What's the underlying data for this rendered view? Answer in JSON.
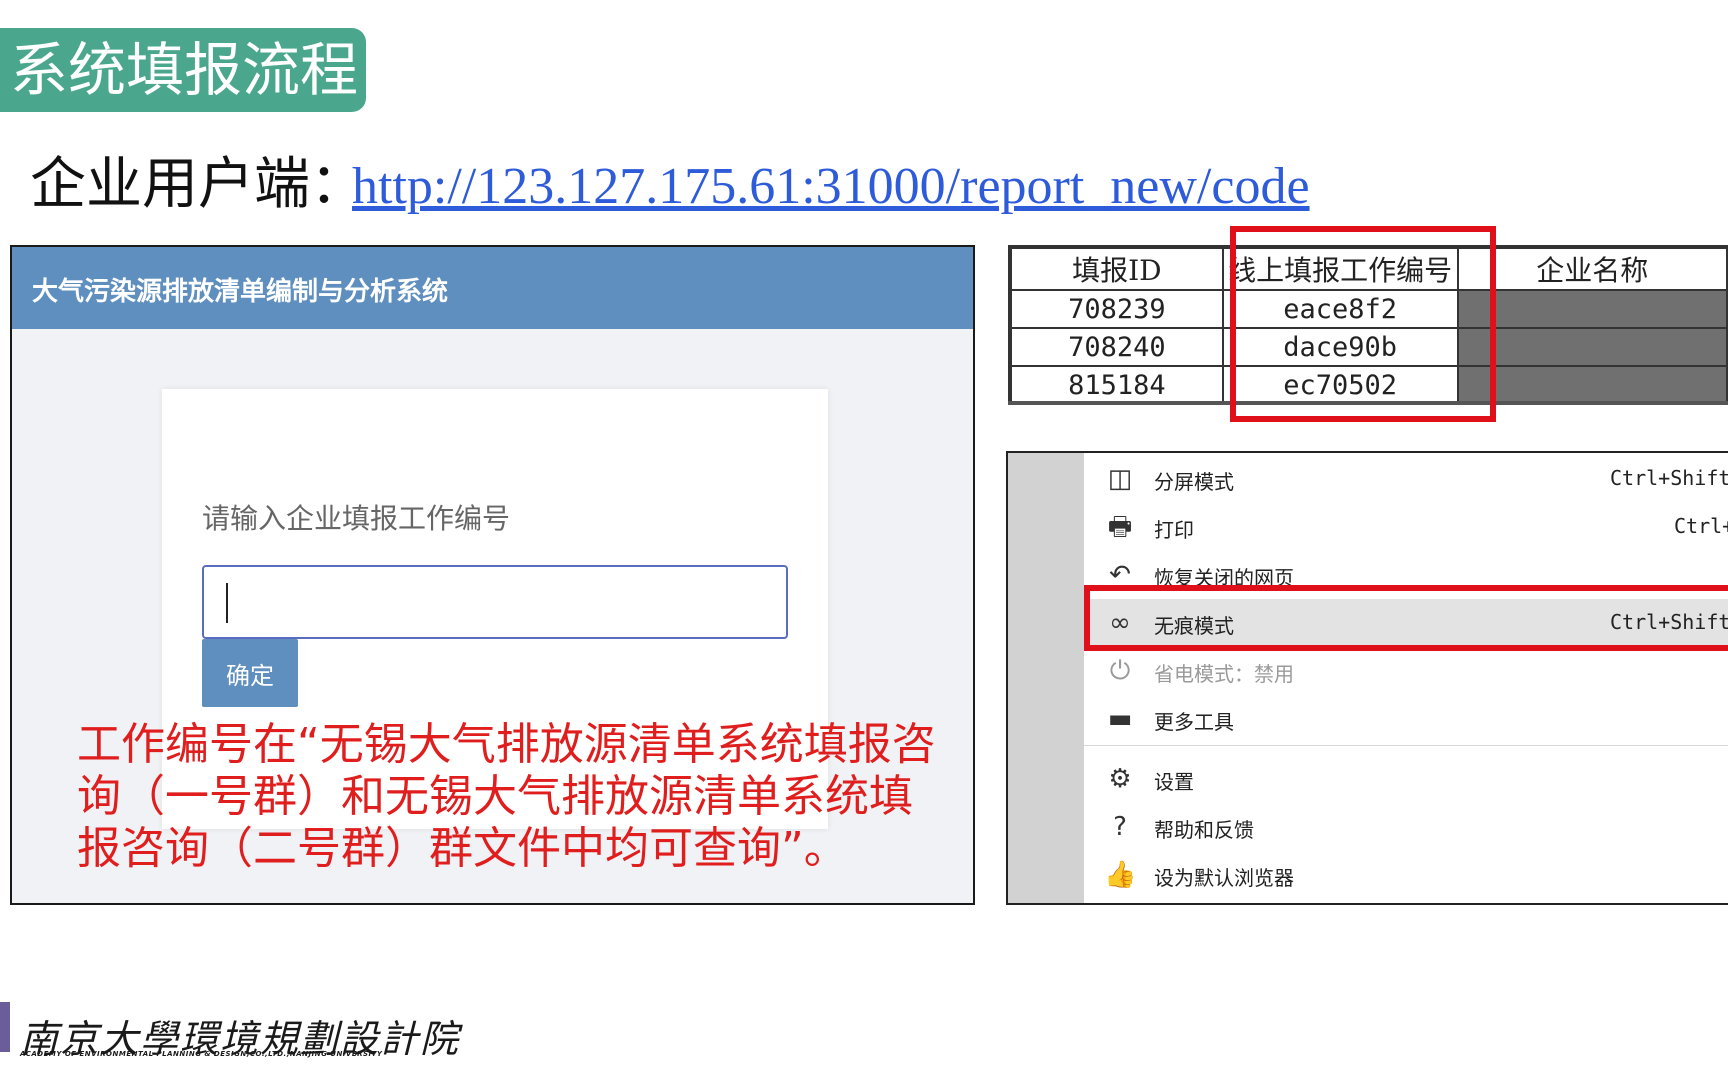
{
  "slide": {
    "title": "系统填报流程",
    "subtitle_label": "企业用户端：",
    "subtitle_url": "http://123.127.175.61:31000/report_new/code",
    "accent_color": "#4aa68c"
  },
  "login": {
    "system_title": "大气污染源排放清单编制与分析系统",
    "prompt": "请输入企业填报工作编号",
    "input_value": "",
    "confirm_label": "确定",
    "header_color": "#5f8fbf"
  },
  "note": {
    "text": "工作编号在“无锡大气排放源清单系统填报咨询（一号群）和无锡大气排放源清单系统填报咨询（二号群）群文件中均可查询”。",
    "color": "#e01e1e"
  },
  "id_table": {
    "headers": [
      "填报ID",
      "线上填报工作编号",
      "企业名称"
    ],
    "rows": [
      [
        "708239",
        "eace8f2",
        ""
      ],
      [
        "708240",
        "dace90b",
        ""
      ],
      [
        "815184",
        "ec70502",
        ""
      ]
    ]
  },
  "context_menu": {
    "items": [
      {
        "icon": "split-screen-icon",
        "glyph": "◫",
        "label": "分屏模式",
        "shortcut": "Ctrl+Shift+",
        "disabled": false,
        "highlighted": false
      },
      {
        "icon": "printer-icon",
        "glyph": "🖶",
        "label": "打印",
        "shortcut": "Ctrl+",
        "disabled": false,
        "highlighted": false
      },
      {
        "icon": "restore-icon",
        "glyph": "↶",
        "label": "恢复关闭的网页",
        "shortcut": "",
        "disabled": false,
        "highlighted": false
      },
      {
        "icon": "incognito-icon",
        "glyph": "∞",
        "label": "无痕模式",
        "shortcut": "Ctrl+Shift+",
        "disabled": false,
        "highlighted": true
      },
      {
        "icon": "power-plug-icon",
        "glyph": "⏻",
        "label": "省电模式：禁用",
        "shortcut": "",
        "disabled": true,
        "highlighted": false
      },
      {
        "icon": "toolbox-icon",
        "glyph": "▬",
        "label": "更多工具",
        "shortcut": "",
        "disabled": false,
        "highlighted": false
      },
      {
        "icon": "gear-icon",
        "glyph": "⚙",
        "label": "设置",
        "shortcut": "",
        "disabled": false,
        "highlighted": false
      },
      {
        "icon": "help-icon",
        "glyph": "?",
        "label": "帮助和反馈",
        "shortcut": "",
        "disabled": false,
        "highlighted": false
      },
      {
        "icon": "thumbs-up-icon",
        "glyph": "👍",
        "label": "设为默认浏览器",
        "shortcut": "",
        "disabled": false,
        "highlighted": false
      }
    ]
  },
  "footer": {
    "org_name": "南京大學環境規劃設計院",
    "org_name_en": "ACADEMY OF ENVIRONMENTAL PLANNING & DESIGN,CO.,LTD.,NANJING UNIVERSITY"
  }
}
